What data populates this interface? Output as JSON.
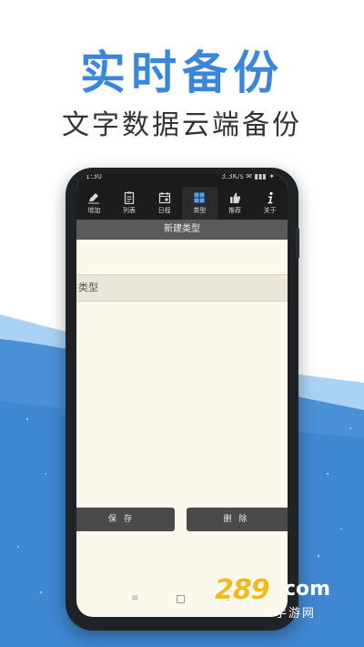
{
  "promo": {
    "headline": "实时备份",
    "subhead": "文字数据云端备份"
  },
  "statusbar": {
    "time": "1:30",
    "right": "3.3K/s ✉ ▮▮▮ ✦"
  },
  "nav": {
    "items": [
      {
        "label": "增加",
        "icon": "pencil-icon"
      },
      {
        "label": "列表",
        "icon": "clipboard-icon"
      },
      {
        "label": "日程",
        "icon": "calendar-icon"
      },
      {
        "label": "类型",
        "icon": "grid-icon"
      },
      {
        "label": "推荐",
        "icon": "thumbs-up-icon"
      },
      {
        "label": "关于",
        "icon": "info-icon"
      }
    ],
    "active_index": 3
  },
  "page": {
    "title": "新建类型"
  },
  "form": {
    "type_field_value": "类型"
  },
  "buttons": {
    "save_label": "保存",
    "delete_label": "删除"
  },
  "sysnav": {
    "menu_glyph": "≡",
    "back_glyph": "◁"
  },
  "watermark": {
    "number": "289",
    "suffix": "com",
    "sub": "手游网"
  },
  "colors": {
    "headline": "#3a86d8",
    "wave_light": "#8fc2ee",
    "wave_dark": "#3e8ad3",
    "watermark": "#f3b81c"
  }
}
